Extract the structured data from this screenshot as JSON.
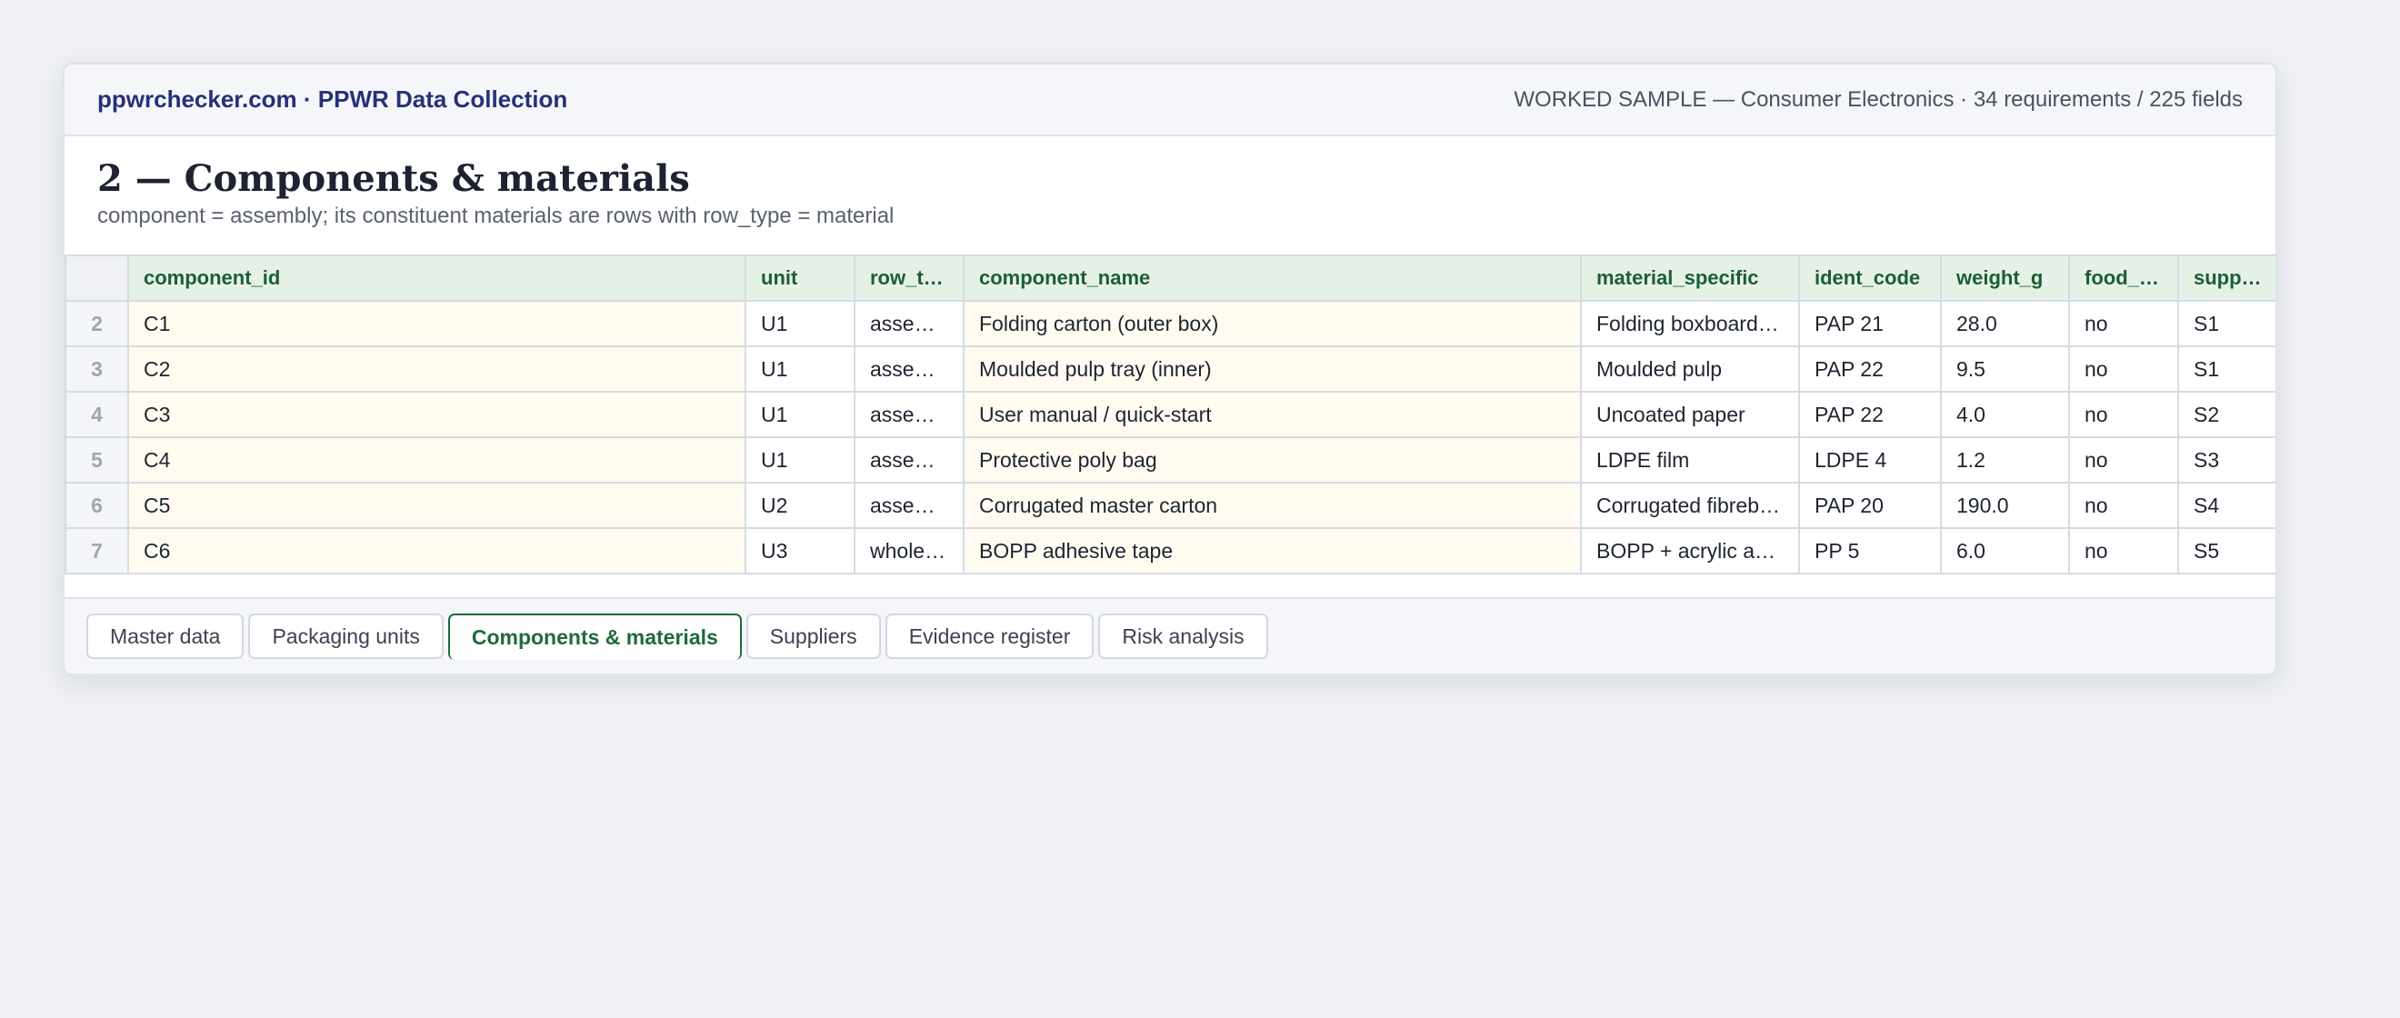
{
  "header": {
    "brand": "ppwrchecker.com · PPWR Data Collection",
    "sample_info": "WORKED SAMPLE — Consumer Electronics · 34 requirements / 225 fields"
  },
  "sheet": {
    "title": "2 — Components & materials",
    "subtitle": "component = assembly; its constituent materials are rows with row_type = material"
  },
  "table": {
    "columns": [
      "component_id",
      "unit",
      "row_t…",
      "component_name",
      "material_specific",
      "ident_code",
      "weight_g",
      "food_…",
      "supp…"
    ],
    "rows": [
      {
        "num": "2",
        "cells": [
          "C1",
          "U1",
          "asse…",
          "Folding carton (outer box)",
          "Folding boxboard…",
          "PAP 21",
          "28.0",
          "no",
          "S1"
        ]
      },
      {
        "num": "3",
        "cells": [
          "C2",
          "U1",
          "asse…",
          "Moulded pulp tray (inner)",
          "Moulded pulp",
          "PAP 22",
          "9.5",
          "no",
          "S1"
        ]
      },
      {
        "num": "4",
        "cells": [
          "C3",
          "U1",
          "asse…",
          "User manual / quick-start",
          "Uncoated paper",
          "PAP 22",
          "4.0",
          "no",
          "S2"
        ]
      },
      {
        "num": "5",
        "cells": [
          "C4",
          "U1",
          "asse…",
          "Protective poly bag",
          "LDPE film",
          "LDPE 4",
          "1.2",
          "no",
          "S3"
        ]
      },
      {
        "num": "6",
        "cells": [
          "C5",
          "U2",
          "asse…",
          "Corrugated master carton",
          "Corrugated fibreb…",
          "PAP 20",
          "190.0",
          "no",
          "S4"
        ]
      },
      {
        "num": "7",
        "cells": [
          "C6",
          "U3",
          "whole…",
          "BOPP adhesive tape",
          "BOPP + acrylic a…",
          "PP 5",
          "6.0",
          "no",
          "S5"
        ]
      }
    ]
  },
  "tabs": [
    {
      "label": "Master data",
      "active": false
    },
    {
      "label": "Packaging units",
      "active": false
    },
    {
      "label": "Components & materials",
      "active": true
    },
    {
      "label": "Suppliers",
      "active": false
    },
    {
      "label": "Evidence register",
      "active": false
    },
    {
      "label": "Risk analysis",
      "active": false
    }
  ],
  "colors": {
    "brand": "#27307a",
    "header_green": "#1c5e35",
    "header_bg": "#e5f1e7",
    "shaded_cell": "#fffbf0",
    "active_tab": "#1f6a3c"
  }
}
